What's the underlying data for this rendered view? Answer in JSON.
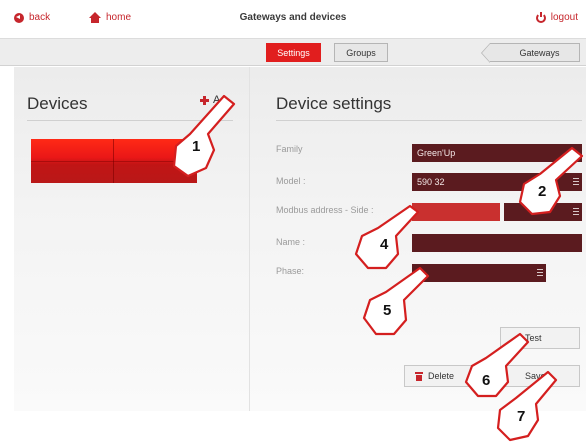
{
  "header": {
    "back_label": "back",
    "home_label": "home",
    "title": "Gateways and devices",
    "logout_label": "logout"
  },
  "tabs": {
    "settings_label": "Settings",
    "groups_label": "Groups",
    "gateways_label": "Gateways"
  },
  "devices_panel": {
    "title": "Devices",
    "add_label": "A"
  },
  "device_settings": {
    "title": "Device settings",
    "fields": {
      "family": {
        "label": "Family",
        "value": "Green'Up"
      },
      "model": {
        "label": "Model :",
        "value": "590 32"
      },
      "modbus": {
        "label": "Modbus address - Side :",
        "value": ""
      },
      "name": {
        "label": "Name :",
        "value": ""
      },
      "phase": {
        "label": "Phase:",
        "value": ""
      }
    },
    "buttons": {
      "test_label": "Test",
      "delete_label": "Delete",
      "save_label": "Save"
    }
  },
  "callouts": [
    "1",
    "2",
    "4",
    "5",
    "6",
    "7"
  ],
  "colors": {
    "accent": "#e11e1e",
    "field_dark": "#5b1b1f",
    "field_bright": "#c9302f",
    "link": "#c6262c"
  }
}
